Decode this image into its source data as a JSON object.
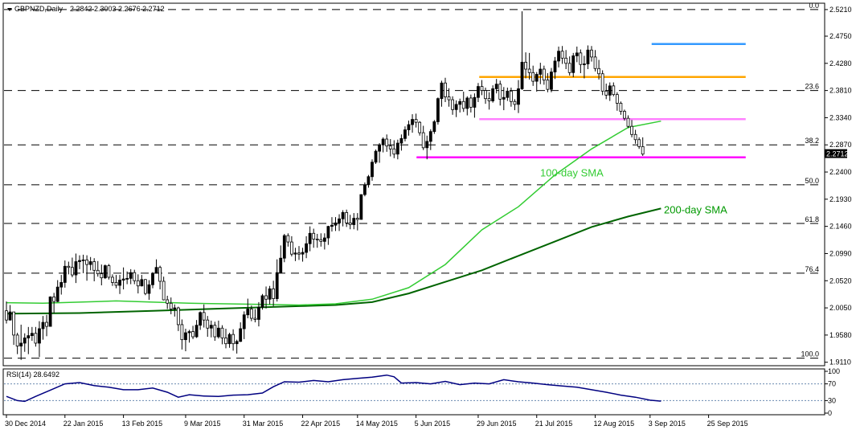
{
  "chart_data": {
    "type": "candlestick",
    "symbol_label": "GBPNZD,Daily",
    "ohlc_label": "2.2842 2.3003 2.2676 2.2712",
    "last_price": "2.2712",
    "ylim": [
      1.905,
      2.532
    ],
    "y_ticks": [
      "2.5210",
      "2.4750",
      "2.4280",
      "2.3810",
      "2.3340",
      "2.2870",
      "2.2400",
      "2.1930",
      "2.1460",
      "2.0990",
      "2.0520",
      "2.0050",
      "1.9580",
      "1.9110"
    ],
    "x_ticks": [
      "30 Dec 2014",
      "22 Jan 2015",
      "13 Feb 2015",
      "9 Mar 2015",
      "31 Mar 2015",
      "22 Apr 2015",
      "14 May 2015",
      "5 Jun 2015",
      "29 Jun 2015",
      "21 Jul 2015",
      "12 Aug 2015",
      "3 Sep 2015",
      "25 Sep 2015"
    ],
    "fib_levels": [
      {
        "label": "0.0",
        "value": 2.521
      },
      {
        "label": "23.6",
        "value": 2.381
      },
      {
        "label": "38.2",
        "value": 2.287
      },
      {
        "label": "50.0",
        "value": 2.218
      },
      {
        "label": "61.8",
        "value": 2.151
      },
      {
        "label": "76.4",
        "value": 2.065
      },
      {
        "label": "100.0",
        "value": 1.918
      }
    ],
    "horizontal_lines": [
      {
        "value": 2.4615,
        "from": "2015-09-03",
        "to": "2015-10-09",
        "color": "#3399ff"
      },
      {
        "value": 2.4045,
        "from": "2015-06-29",
        "to": "2015-10-09",
        "color": "#ffa500"
      },
      {
        "value": 2.3315,
        "from": "2015-06-29",
        "to": "2015-10-09",
        "color": "#ff80ff"
      },
      {
        "value": 2.2655,
        "from": "2015-06-05",
        "to": "2015-10-09",
        "color": "#ff00ff"
      }
    ],
    "sma_labels": [
      {
        "text": "100-day SMA",
        "color": "#33cc33"
      },
      {
        "text": "200-day SMA",
        "color": "#009900"
      }
    ],
    "sma100": [
      [
        0,
        2.014
      ],
      [
        10,
        2.013
      ],
      [
        20,
        2.015
      ],
      [
        30,
        2.017
      ],
      [
        40,
        2.015
      ],
      [
        50,
        2.013
      ],
      [
        60,
        2.012
      ],
      [
        70,
        2.011
      ],
      [
        80,
        2.01
      ],
      [
        90,
        2.012
      ],
      [
        100,
        2.02
      ],
      [
        110,
        2.04
      ],
      [
        120,
        2.08
      ],
      [
        130,
        2.14
      ],
      [
        140,
        2.18
      ],
      [
        150,
        2.235
      ],
      [
        160,
        2.28
      ],
      [
        170,
        2.317
      ],
      [
        179,
        2.328
      ]
    ],
    "sma200": [
      [
        0,
        1.995
      ],
      [
        20,
        1.996
      ],
      [
        40,
        2.0
      ],
      [
        60,
        2.004
      ],
      [
        80,
        2.008
      ],
      [
        90,
        2.01
      ],
      [
        100,
        2.015
      ],
      [
        110,
        2.03
      ],
      [
        120,
        2.05
      ],
      [
        130,
        2.07
      ],
      [
        140,
        2.095
      ],
      [
        150,
        2.12
      ],
      [
        160,
        2.145
      ],
      [
        170,
        2.163
      ],
      [
        179,
        2.177
      ]
    ],
    "rsi": {
      "label": "RSI(14) 28.6492",
      "ticks": [
        "100",
        "70",
        "30",
        "0"
      ],
      "levels": [
        70,
        30
      ],
      "ylim": [
        0,
        100
      ],
      "points": [
        [
          0,
          40
        ],
        [
          3,
          30
        ],
        [
          5,
          28
        ],
        [
          8,
          40
        ],
        [
          12,
          55
        ],
        [
          16,
          70
        ],
        [
          20,
          73
        ],
        [
          24,
          66
        ],
        [
          28,
          62
        ],
        [
          32,
          56
        ],
        [
          36,
          56
        ],
        [
          40,
          60
        ],
        [
          44,
          50
        ],
        [
          47,
          38
        ],
        [
          50,
          44
        ],
        [
          54,
          41
        ],
        [
          58,
          40
        ],
        [
          62,
          43
        ],
        [
          66,
          44
        ],
        [
          70,
          48
        ],
        [
          73,
          63
        ],
        [
          76,
          75
        ],
        [
          80,
          74
        ],
        [
          84,
          78
        ],
        [
          88,
          75
        ],
        [
          92,
          80
        ],
        [
          96,
          83
        ],
        [
          100,
          86
        ],
        [
          104,
          91
        ],
        [
          106,
          87
        ],
        [
          108,
          72
        ],
        [
          112,
          73
        ],
        [
          116,
          70
        ],
        [
          120,
          76
        ],
        [
          124,
          68
        ],
        [
          128,
          72
        ],
        [
          132,
          70
        ],
        [
          136,
          80
        ],
        [
          140,
          75
        ],
        [
          144,
          72
        ],
        [
          148,
          68
        ],
        [
          152,
          65
        ],
        [
          156,
          62
        ],
        [
          160,
          56
        ],
        [
          164,
          50
        ],
        [
          168,
          43
        ],
        [
          172,
          38
        ],
        [
          176,
          31
        ],
        [
          179,
          28.6
        ]
      ]
    },
    "bars": [
      [
        2.0,
        2.016,
        1.978,
        1.984
      ],
      [
        1.984,
        2.01,
        1.983,
        1.998
      ],
      [
        1.998,
        1.998,
        1.941,
        1.958
      ],
      [
        1.958,
        1.962,
        1.925,
        1.939
      ],
      [
        1.939,
        1.976,
        1.915,
        1.944
      ],
      [
        1.944,
        1.961,
        1.929,
        1.953
      ],
      [
        1.953,
        1.972,
        1.925,
        1.957
      ],
      [
        1.957,
        1.972,
        1.948,
        1.961
      ],
      [
        1.961,
        1.972,
        1.938,
        1.944
      ],
      [
        1.944,
        1.982,
        1.92,
        1.969
      ],
      [
        1.969,
        1.991,
        1.95,
        1.98
      ],
      [
        1.98,
        1.993,
        1.956,
        1.973
      ],
      [
        1.973,
        2.025,
        1.973,
        2.024
      ],
      [
        2.024,
        2.031,
        1.996,
        2.016
      ],
      [
        2.016,
        2.053,
        2.015,
        2.041
      ],
      [
        2.041,
        2.062,
        2.028,
        2.049
      ],
      [
        2.049,
        2.087,
        2.04,
        2.077
      ],
      [
        2.077,
        2.085,
        2.063,
        2.075
      ],
      [
        2.075,
        2.092,
        2.058,
        2.062
      ],
      [
        2.062,
        2.099,
        2.048,
        2.085
      ],
      [
        2.085,
        2.096,
        2.072,
        2.087
      ],
      [
        2.087,
        2.097,
        2.065,
        2.088
      ],
      [
        2.088,
        2.096,
        2.052,
        2.08
      ],
      [
        2.08,
        2.093,
        2.07,
        2.085
      ],
      [
        2.085,
        2.091,
        2.051,
        2.07
      ],
      [
        2.07,
        2.086,
        2.059,
        2.064
      ],
      [
        2.064,
        2.08,
        2.044,
        2.057
      ],
      [
        2.057,
        2.08,
        2.055,
        2.078
      ],
      [
        2.078,
        2.081,
        2.054,
        2.058
      ],
      [
        2.058,
        2.063,
        2.043,
        2.049
      ],
      [
        2.049,
        2.062,
        2.039,
        2.044
      ],
      [
        2.044,
        2.062,
        2.029,
        2.053
      ],
      [
        2.053,
        2.075,
        2.037,
        2.055
      ],
      [
        2.055,
        2.068,
        2.046,
        2.056
      ],
      [
        2.056,
        2.072,
        2.046,
        2.066
      ],
      [
        2.066,
        2.071,
        2.046,
        2.052
      ],
      [
        2.052,
        2.063,
        2.03,
        2.043
      ],
      [
        2.043,
        2.062,
        2.042,
        2.054
      ],
      [
        2.054,
        2.055,
        2.027,
        2.03
      ],
      [
        2.03,
        2.053,
        2.019,
        2.045
      ],
      [
        2.045,
        2.067,
        2.039,
        2.065
      ],
      [
        2.065,
        2.089,
        2.065,
        2.075
      ],
      [
        2.075,
        2.078,
        2.037,
        2.051
      ],
      [
        2.051,
        2.059,
        2.018,
        2.019
      ],
      [
        2.019,
        2.026,
        2.003,
        2.013
      ],
      [
        2.013,
        2.023,
        1.994,
        2.003
      ],
      [
        2.003,
        2.011,
        1.99,
        2.005
      ],
      [
        2.005,
        2.007,
        1.965,
        1.976
      ],
      [
        1.976,
        1.985,
        1.933,
        1.95
      ],
      [
        1.95,
        1.969,
        1.93,
        1.962
      ],
      [
        1.962,
        1.967,
        1.945,
        1.964
      ],
      [
        1.964,
        1.974,
        1.951,
        1.955
      ],
      [
        1.955,
        1.984,
        1.953,
        1.975
      ],
      [
        1.975,
        1.999,
        1.967,
        1.997
      ],
      [
        1.997,
        2.011,
        1.971,
        1.984
      ],
      [
        1.984,
        1.991,
        1.955,
        1.97
      ],
      [
        1.97,
        1.983,
        1.954,
        1.975
      ],
      [
        1.975,
        1.981,
        1.948,
        1.955
      ],
      [
        1.955,
        1.983,
        1.952,
        1.97
      ],
      [
        1.97,
        1.975,
        1.942,
        1.953
      ],
      [
        1.953,
        1.969,
        1.935,
        1.943
      ],
      [
        1.943,
        1.962,
        1.936,
        1.959
      ],
      [
        1.959,
        1.968,
        1.931,
        1.943
      ],
      [
        1.943,
        1.95,
        1.926,
        1.947
      ],
      [
        1.947,
        1.98,
        1.946,
        1.969
      ],
      [
        1.969,
        1.999,
        1.951,
        1.993
      ],
      [
        1.993,
        2.021,
        1.987,
        2.003
      ],
      [
        2.003,
        2.009,
        1.982,
        1.987
      ],
      [
        1.987,
        2.003,
        1.98,
        1.985
      ],
      [
        1.985,
        2.015,
        1.973,
        2.006
      ],
      [
        2.006,
        2.029,
        2.002,
        2.026
      ],
      [
        2.026,
        2.042,
        2.004,
        2.02
      ],
      [
        2.02,
        2.043,
        2.011,
        2.038
      ],
      [
        2.038,
        2.052,
        2.008,
        2.021
      ],
      [
        2.021,
        2.089,
        2.016,
        2.066
      ],
      [
        2.066,
        2.113,
        2.065,
        2.091
      ],
      [
        2.091,
        2.133,
        2.084,
        2.13
      ],
      [
        2.13,
        2.134,
        2.111,
        2.119
      ],
      [
        2.119,
        2.129,
        2.094,
        2.098
      ],
      [
        2.098,
        2.109,
        2.086,
        2.1
      ],
      [
        2.1,
        2.112,
        2.088,
        2.098
      ],
      [
        2.098,
        2.109,
        2.085,
        2.101
      ],
      [
        2.101,
        2.129,
        2.091,
        2.116
      ],
      [
        2.116,
        2.146,
        2.103,
        2.134
      ],
      [
        2.134,
        2.142,
        2.109,
        2.124
      ],
      [
        2.124,
        2.133,
        2.109,
        2.123
      ],
      [
        2.123,
        2.134,
        2.111,
        2.12
      ],
      [
        2.12,
        2.134,
        2.106,
        2.126
      ],
      [
        2.126,
        2.147,
        2.114,
        2.146
      ],
      [
        2.146,
        2.162,
        2.137,
        2.148
      ],
      [
        2.148,
        2.162,
        2.138,
        2.152
      ],
      [
        2.152,
        2.167,
        2.138,
        2.159
      ],
      [
        2.159,
        2.174,
        2.146,
        2.17
      ],
      [
        2.17,
        2.175,
        2.145,
        2.152
      ],
      [
        2.152,
        2.166,
        2.141,
        2.149
      ],
      [
        2.149,
        2.169,
        2.141,
        2.16
      ],
      [
        2.16,
        2.169,
        2.139,
        2.158
      ],
      [
        2.158,
        2.161,
        2.192,
        2.201
      ],
      [
        2.201,
        2.222,
        2.198,
        2.218
      ],
      [
        2.218,
        2.235,
        2.213,
        2.232
      ],
      [
        2.232,
        2.262,
        2.225,
        2.257
      ],
      [
        2.257,
        2.279,
        2.254,
        2.276
      ],
      [
        2.276,
        2.29,
        2.256,
        2.287
      ],
      [
        2.287,
        2.3,
        2.274,
        2.297
      ],
      [
        2.297,
        2.305,
        2.275,
        2.285
      ],
      [
        2.285,
        2.297,
        2.267,
        2.28
      ],
      [
        2.28,
        2.295,
        2.264,
        2.271
      ],
      [
        2.271,
        2.296,
        2.262,
        2.29
      ],
      [
        2.29,
        2.305,
        2.277,
        2.298
      ],
      [
        2.298,
        2.319,
        2.293,
        2.313
      ],
      [
        2.313,
        2.329,
        2.303,
        2.322
      ],
      [
        2.322,
        2.34,
        2.308,
        2.331
      ],
      [
        2.331,
        2.341,
        2.317,
        2.326
      ],
      [
        2.326,
        2.328,
        2.303,
        2.308
      ],
      [
        2.308,
        2.32,
        2.278,
        2.282
      ],
      [
        2.282,
        2.303,
        2.262,
        2.293
      ],
      [
        2.293,
        2.314,
        2.278,
        2.31
      ],
      [
        2.31,
        2.33,
        2.306,
        2.327
      ],
      [
        2.327,
        2.369,
        2.322,
        2.367
      ],
      [
        2.367,
        2.398,
        2.353,
        2.394
      ],
      [
        2.394,
        2.403,
        2.361,
        2.37
      ],
      [
        2.37,
        2.385,
        2.353,
        2.365
      ],
      [
        2.365,
        2.371,
        2.339,
        2.348
      ],
      [
        2.348,
        2.364,
        2.335,
        2.357
      ],
      [
        2.357,
        2.367,
        2.343,
        2.362
      ],
      [
        2.362,
        2.379,
        2.344,
        2.35
      ],
      [
        2.35,
        2.371,
        2.338,
        2.368
      ],
      [
        2.368,
        2.374,
        2.343,
        2.352
      ],
      [
        2.352,
        2.376,
        2.334,
        2.369
      ],
      [
        2.369,
        2.394,
        2.361,
        2.388
      ],
      [
        2.388,
        2.399,
        2.373,
        2.381
      ],
      [
        2.381,
        2.386,
        2.358,
        2.367
      ],
      [
        2.367,
        2.378,
        2.348,
        2.363
      ],
      [
        2.363,
        2.39,
        2.36,
        2.384
      ],
      [
        2.384,
        2.401,
        2.376,
        2.392
      ],
      [
        2.392,
        2.398,
        2.355,
        2.366
      ],
      [
        2.366,
        2.387,
        2.347,
        2.369
      ],
      [
        2.369,
        2.386,
        2.363,
        2.38
      ],
      [
        2.38,
        2.386,
        2.353,
        2.362
      ],
      [
        2.362,
        2.366,
        2.347,
        2.357
      ],
      [
        2.357,
        2.399,
        2.342,
        2.384
      ],
      [
        2.384,
        2.518,
        2.382,
        2.43
      ],
      [
        2.43,
        2.447,
        2.402,
        2.418
      ],
      [
        2.418,
        2.446,
        2.4,
        2.412
      ],
      [
        2.412,
        2.424,
        2.389,
        2.397
      ],
      [
        2.397,
        2.413,
        2.379,
        2.409
      ],
      [
        2.409,
        2.429,
        2.392,
        2.418
      ],
      [
        2.418,
        2.424,
        2.391,
        2.399
      ],
      [
        2.399,
        2.411,
        2.378,
        2.383
      ],
      [
        2.383,
        2.42,
        2.378,
        2.413
      ],
      [
        2.413,
        2.439,
        2.401,
        2.432
      ],
      [
        2.432,
        2.457,
        2.421,
        2.449
      ],
      [
        2.449,
        2.458,
        2.427,
        2.437
      ],
      [
        2.437,
        2.451,
        2.418,
        2.428
      ],
      [
        2.428,
        2.44,
        2.407,
        2.412
      ],
      [
        2.412,
        2.446,
        2.404,
        2.441
      ],
      [
        2.441,
        2.457,
        2.43,
        2.446
      ],
      [
        2.446,
        2.452,
        2.411,
        2.426
      ],
      [
        2.426,
        2.441,
        2.402,
        2.427
      ],
      [
        2.427,
        2.459,
        2.418,
        2.451
      ],
      [
        2.451,
        2.458,
        2.431,
        2.439
      ],
      [
        2.439,
        2.451,
        2.414,
        2.419
      ],
      [
        2.419,
        2.434,
        2.4,
        2.41
      ],
      [
        2.41,
        2.416,
        2.373,
        2.38
      ],
      [
        2.38,
        2.393,
        2.366,
        2.373
      ],
      [
        2.373,
        2.395,
        2.363,
        2.389
      ],
      [
        2.389,
        2.395,
        2.371,
        2.374
      ],
      [
        2.374,
        2.378,
        2.346,
        2.359
      ],
      [
        2.359,
        2.362,
        2.339,
        2.345
      ],
      [
        2.345,
        2.348,
        2.329,
        2.333
      ],
      [
        2.333,
        2.338,
        2.316,
        2.319
      ],
      [
        2.319,
        2.33,
        2.3,
        2.305
      ],
      [
        2.305,
        2.313,
        2.289,
        2.296
      ],
      [
        2.296,
        2.3,
        2.28,
        2.284
      ],
      [
        2.284,
        2.3,
        2.268,
        2.271
      ]
    ]
  }
}
